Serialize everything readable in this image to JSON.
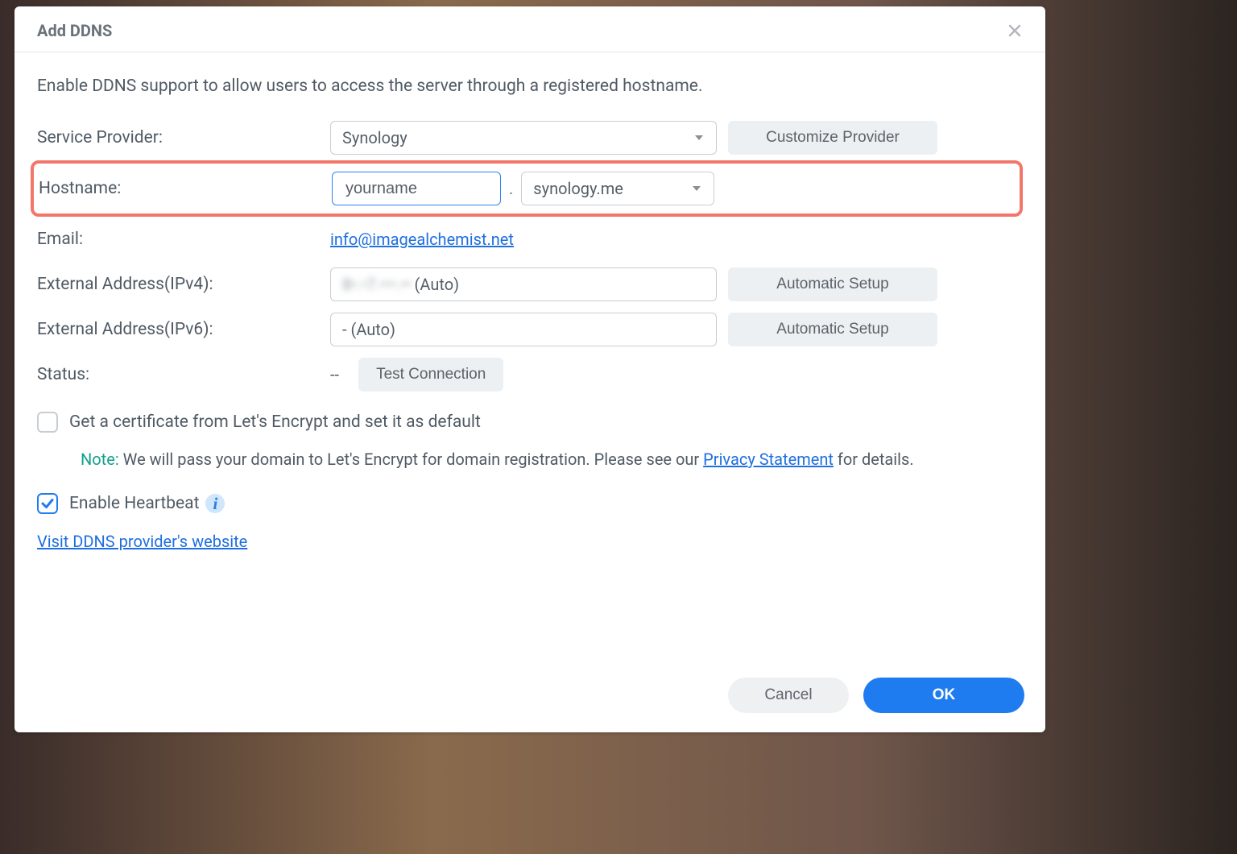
{
  "dialog": {
    "title": "Add DDNS",
    "intro": "Enable DDNS support to allow users to access the server through a registered hostname."
  },
  "serviceProvider": {
    "label": "Service Provider:",
    "selected": "Synology",
    "customizeBtn": "Customize Provider"
  },
  "hostname": {
    "label": "Hostname:",
    "value": "yourname",
    "dot": ".",
    "domain": "synology.me"
  },
  "email": {
    "label": "Email:",
    "value": "info@imagealchemist.net"
  },
  "ipv4": {
    "label": "External Address(IPv4):",
    "masked": "8•.•7.•••.••",
    "suffix": " (Auto)",
    "autoBtn": "Automatic Setup"
  },
  "ipv6": {
    "label": "External Address(IPv6):",
    "value": "- (Auto)",
    "autoBtn": "Automatic Setup"
  },
  "status": {
    "label": "Status:",
    "value": "--",
    "testBtn": "Test Connection"
  },
  "letsEncrypt": {
    "label": "Get a certificate from Let's Encrypt and set it as default",
    "noteLabel": "Note:",
    "noteTextPrefix": " We will pass your domain to Let's Encrypt for domain registration. Please see our ",
    "privacyLink": "Privacy Statement",
    "noteTextSuffix": " for details."
  },
  "heartbeat": {
    "label": "Enable Heartbeat"
  },
  "visitLink": "Visit DDNS provider's website",
  "footer": {
    "cancel": "Cancel",
    "ok": "OK"
  }
}
